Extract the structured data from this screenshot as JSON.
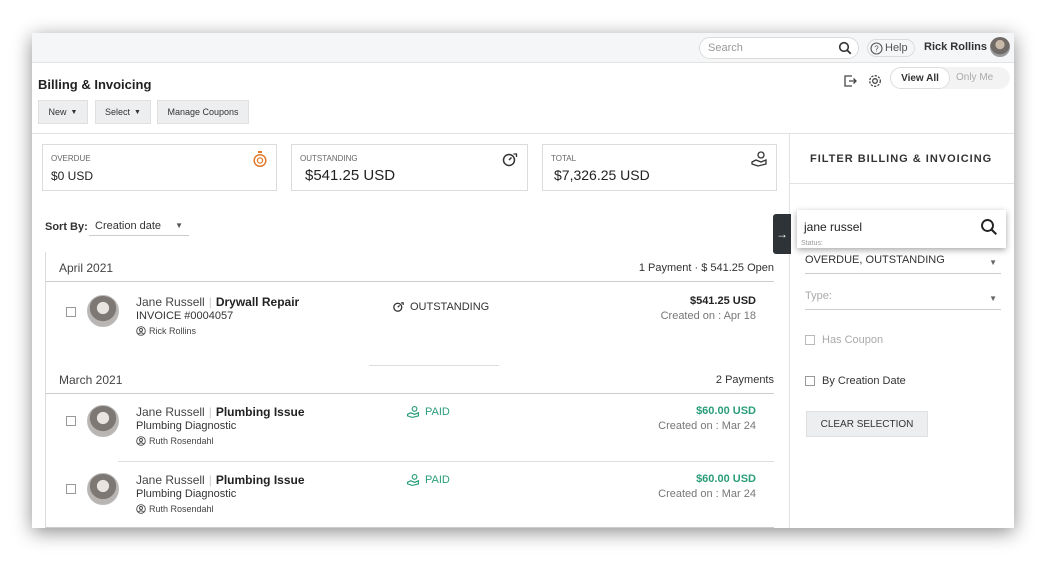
{
  "topbar": {
    "search_placeholder": "Search",
    "help_label": "Help",
    "user_name": "Rick Rollins"
  },
  "header": {
    "title": "Billing & Invoicing",
    "new_label": "New",
    "select_label": "Select",
    "manage_coupons_label": "Manage Coupons",
    "view_all_label": "View All",
    "only_me_label": "Only Me"
  },
  "stats": [
    {
      "label": "OVERDUE",
      "value": "$0 USD",
      "icon": "stopwatch-icon",
      "color": "#e07a2e"
    },
    {
      "label": "OUTSTANDING",
      "value": "$541.25 USD",
      "icon": "timer-arrow-icon",
      "color": "#333333"
    },
    {
      "label": "TOTAL",
      "value": "$7,326.25 USD",
      "icon": "money-hand-icon",
      "color": "#333333"
    }
  ],
  "sort": {
    "label": "Sort By:",
    "value": "Creation date"
  },
  "groups": [
    {
      "month": "April 2021",
      "summary": "1 Payment  · $ 541.25 Open",
      "rows": [
        {
          "customer": "Jane Russell",
          "job": "Drywall Repair",
          "subtitle": "INVOICE #0004057",
          "tech": "Rick Rollins",
          "status": "OUTSTANDING",
          "amount": "$541.25 USD",
          "created": "Created on : Apr 18"
        }
      ]
    },
    {
      "month": "March 2021",
      "summary": "2 Payments",
      "rows": [
        {
          "customer": "Jane Russell",
          "job": "Plumbing Issue",
          "subtitle": "Plumbing Diagnostic",
          "tech": "Ruth Rosendahl",
          "status": "PAID",
          "amount": "$60.00 USD",
          "created": "Created on : Mar 24"
        },
        {
          "customer": "Jane Russell",
          "job": "Plumbing Issue",
          "subtitle": "Plumbing Diagnostic",
          "tech": "Ruth Rosendahl",
          "status": "PAID",
          "amount": "$60.00 USD",
          "created": "Created on : Mar 24"
        }
      ]
    }
  ],
  "colors": {
    "paid": "#2a9d7a",
    "outstanding": "#333333",
    "accent_orange": "#e07a2e"
  },
  "filter": {
    "title": "FILTER BILLING & INVOICING",
    "search_value": "jane russel",
    "status_label": "Status:",
    "status_value": "OVERDUE, OUTSTANDING",
    "type_placeholder": "Type:",
    "has_coupon_label": "Has Coupon",
    "by_creation_date_label": "By Creation Date",
    "clear_label": "CLEAR SELECTION"
  }
}
